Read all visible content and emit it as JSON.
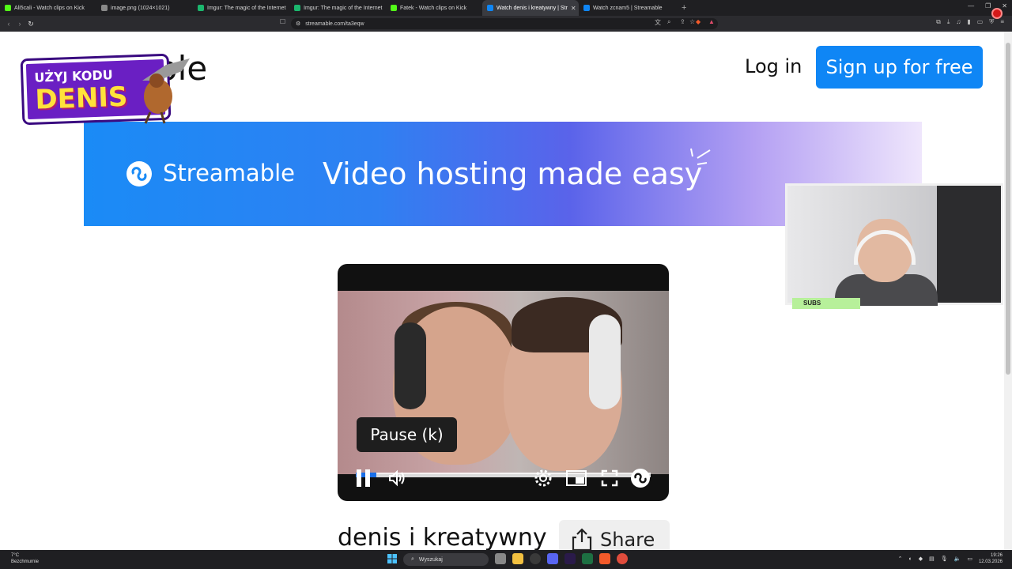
{
  "browser": {
    "tabs": [
      {
        "title": "Ali5cali - Watch clips on Kick",
        "color": "#53fc18"
      },
      {
        "title": "image.png (1024×1021)",
        "color": "#888888"
      },
      {
        "title": "Imgur: The magic of the Internet",
        "color": "#1bb76e"
      },
      {
        "title": "Imgur: The magic of the Internet",
        "color": "#1bb76e"
      },
      {
        "title": "Fatek - Watch clips on Kick",
        "color": "#53fc18"
      },
      {
        "title": "Watch denis i kreatywny | Str",
        "color": "#0f86f5",
        "active": true
      },
      {
        "title": "Watch zcnam5 | Streamable",
        "color": "#0f86f5"
      }
    ],
    "url": "streamable.com/ta3eqw"
  },
  "header": {
    "logo_text": "ble",
    "login_label": "Log in",
    "signup_label": "Sign up for free"
  },
  "banner": {
    "logo_text": "Streamable",
    "tagline": "Video hosting made easy"
  },
  "player": {
    "tooltip": "Pause (k)",
    "progress": 0.07
  },
  "video": {
    "title": "denis i kreatywny",
    "share_label": "Share"
  },
  "promo": {
    "line1": "UŻYJ KODU",
    "line2": "DENIS"
  },
  "webcam": {
    "subs_label": "SUBS"
  },
  "taskbar": {
    "weather_temp": "7°C",
    "weather_desc": "Bezchmurnie",
    "search_placeholder": "Wyszukaj",
    "time": "19:26",
    "date": "12.03.2026"
  }
}
